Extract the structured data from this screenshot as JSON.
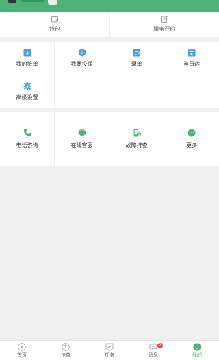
{
  "summary": [
    {
      "label": "钱包",
      "icon": "wallet-icon"
    },
    {
      "label": "服务评价",
      "icon": "edit-icon"
    }
  ],
  "section1": [
    {
      "label": "我的接单",
      "icon": "download-icon",
      "color": "#4a9fe0"
    },
    {
      "label": "我要投保",
      "icon": "shield-icon",
      "color": "#4a9fe0"
    },
    {
      "label": "录单",
      "icon": "edit-note-icon",
      "color": "#4a9fe0"
    },
    {
      "label": "当日达",
      "icon": "calendar-icon",
      "color": "#4a9fe0"
    },
    {
      "label": "高级设置",
      "icon": "gear-icon",
      "color": "#4a9fe0"
    }
  ],
  "section2": [
    {
      "label": "电话咨询",
      "icon": "phone-icon",
      "color": "#4cb374"
    },
    {
      "label": "在线客服",
      "icon": "headset-icon",
      "color": "#4cb374"
    },
    {
      "label": "故障排查",
      "icon": "device-icon",
      "color": "#4cb374"
    },
    {
      "label": "更多",
      "icon": "more-icon",
      "color": "#4cb374"
    }
  ],
  "tabs": [
    {
      "label": "首页",
      "icon": "home-yen-icon"
    },
    {
      "label": "抢单",
      "icon": "grab-order-icon"
    },
    {
      "label": "任务",
      "icon": "task-icon"
    },
    {
      "label": "消息",
      "icon": "message-icon",
      "badge": "2"
    },
    {
      "label": "我的",
      "icon": "smile-icon",
      "active": true
    }
  ],
  "colors": {
    "accent": "#4cb374",
    "blue": "#4a9fe0",
    "badge": "#e8453c"
  }
}
